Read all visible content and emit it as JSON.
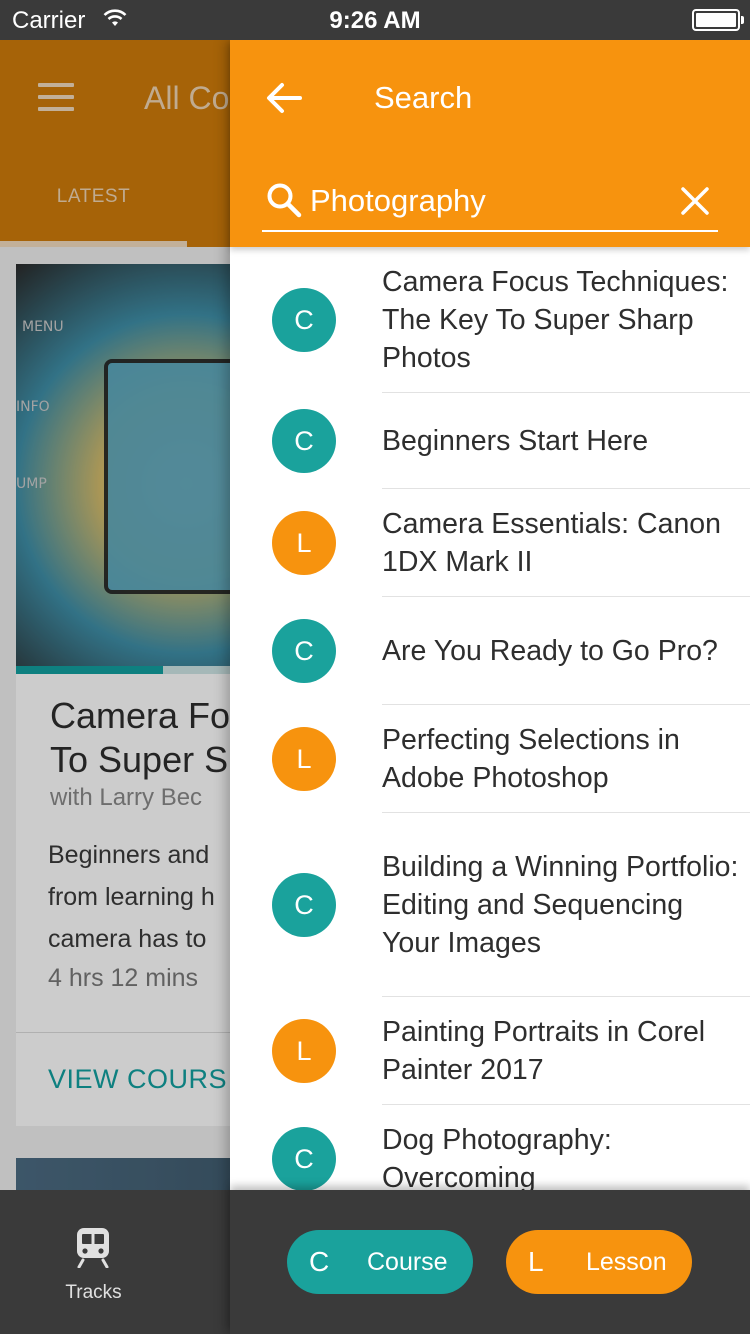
{
  "status_bar": {
    "carrier": "Carrier",
    "time": "9:26 AM"
  },
  "background_app": {
    "header_title": "All Co",
    "active_tab": "LATEST",
    "card": {
      "title": "Camera Fo\nTo Super S",
      "author": "with Larry Bec",
      "description": "Beginners and\nfrom learning h\ncamera has to",
      "duration": "4 hrs 12 mins",
      "link": "VIEW COURS",
      "progress": 0.2
    },
    "bottom_nav": {
      "tracks_label": "Tracks",
      "tracks_icon": "train-icon"
    }
  },
  "drawer": {
    "title": "Search",
    "search_value": "Photography",
    "results": [
      {
        "type": "course",
        "badge": "C",
        "title": "Camera Focus Techniques: The Key To Super Sharp Photos"
      },
      {
        "type": "course",
        "badge": "C",
        "title": "Beginners Start Here"
      },
      {
        "type": "lesson",
        "badge": "L",
        "title": "Camera Essentials: Canon 1DX Mark II"
      },
      {
        "type": "course",
        "badge": "C",
        "title": "Are You Ready to Go Pro?"
      },
      {
        "type": "lesson",
        "badge": "L",
        "title": "Perfecting Selections in Adobe Photoshop"
      },
      {
        "type": "course",
        "badge": "C",
        "title": "Building a Winning Portfolio: Editing and Sequencing Your Images"
      },
      {
        "type": "lesson",
        "badge": "L",
        "title": "Painting Portraits in Corel Painter 2017"
      },
      {
        "type": "course",
        "badge": "C",
        "title": "Dog Photography: Overcoming"
      }
    ],
    "legend": {
      "course_letter": "C",
      "course_label": "Course",
      "lesson_letter": "L",
      "lesson_label": "Lesson"
    }
  },
  "colors": {
    "accent_orange": "#f7930e",
    "teal": "#1aa29c",
    "dark_bar": "#3a3a3a"
  }
}
